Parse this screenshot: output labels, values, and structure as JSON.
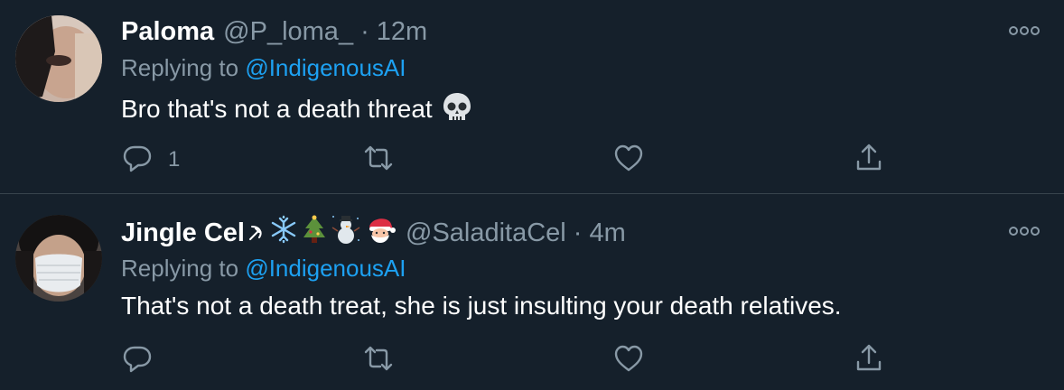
{
  "tweets": [
    {
      "name": "Paloma",
      "handle": "@P_loma_",
      "separator": "·",
      "time": "12m",
      "replying_prefix": "Replying to",
      "replying_to": "@IndigenousAI",
      "text": "Bro that's not a death threat",
      "text_emoji": "skull",
      "reply_count": "1",
      "avatar": "face-photo"
    },
    {
      "name": "Jingle Cel",
      "name_emojis": [
        "hammer-sickle",
        "snowflake",
        "christmas-tree",
        "snowman",
        "santa"
      ],
      "handle": "@SaladitaCel",
      "separator": "·",
      "time": "4m",
      "replying_prefix": "Replying to",
      "replying_to": "@IndigenousAI",
      "text": "That's not a death treat, she is just insulting your death relatives.",
      "reply_count": "",
      "avatar": "masked-face-photo"
    }
  ],
  "colors": {
    "background": "#15202b",
    "secondary_text": "#8899a6",
    "link": "#1da1f2",
    "divider": "#38444d"
  },
  "icons": [
    "reply-icon",
    "retweet-icon",
    "like-icon",
    "share-icon",
    "more-icon"
  ]
}
